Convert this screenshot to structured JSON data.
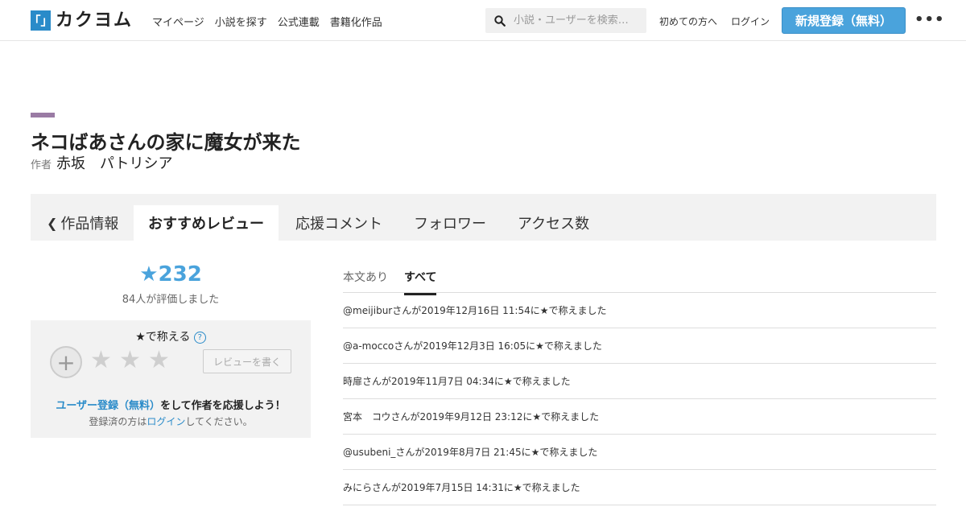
{
  "header": {
    "logo_mark": "「」",
    "logo_text": "カクヨム",
    "nav": [
      "マイページ",
      "小説を探す",
      "公式連載",
      "書籍化作品"
    ],
    "search_placeholder": "小説・ユーザーを検索…",
    "first_time": "初めての方へ",
    "login": "ログイン",
    "signup": "新規登録（無料）",
    "more": "•••"
  },
  "work": {
    "title": "ネコばあさんの家に魔女が来た",
    "author_label": "作者",
    "author_name": "赤坂　パトリシア"
  },
  "tabs": {
    "info": "作品情報",
    "reviews": "おすすめレビュー",
    "comments": "応援コメント",
    "followers": "フォロワー",
    "access": "アクセス数"
  },
  "stats": {
    "stars": "★232",
    "raters": "84人が評価しました"
  },
  "praise": {
    "heading": "★で称える",
    "help": "?",
    "plus": "+",
    "star": "★",
    "write_review": "レビューを書く",
    "signup_link": "ユーザー登録（無料）",
    "signup_suffix": "をして作者を応援しよう！",
    "login_prefix": "登録済の方は",
    "login_link": "ログイン",
    "login_suffix": "してください。"
  },
  "subtabs": {
    "with_text": "本文あり",
    "all": "すべて"
  },
  "reviews": [
    {
      "user": "@meijibur",
      "text": "さんが2019年12月16日 11:54に★で称えました"
    },
    {
      "user": "@a-mocco",
      "text": "さんが2019年12月3日 16:05に★で称えました"
    },
    {
      "user": "時扉",
      "text": "さんが2019年11月7日 04:34に★で称えました"
    },
    {
      "user": "宮本　コウ",
      "text": "さんが2019年9月12日 23:12に★で称えました"
    },
    {
      "user": "@usubeni_",
      "text": "さんが2019年8月7日 21:45に★で称えました"
    },
    {
      "user": "みにら",
      "text": "さんが2019年7月15日 14:31に★で称えました"
    }
  ],
  "colors": {
    "accent": "#4aa3dc",
    "link": "#2a8bc9",
    "title_bar": "#9a7ba4"
  }
}
